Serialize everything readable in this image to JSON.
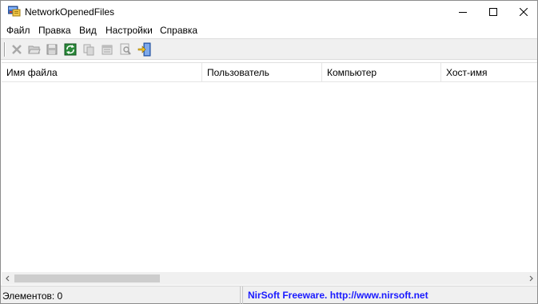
{
  "window": {
    "title": "NetworkOpenedFiles"
  },
  "menu": {
    "items": [
      "Файл",
      "Правка",
      "Вид",
      "Настройки",
      "Справка"
    ]
  },
  "toolbar": {
    "buttons": [
      {
        "icon": "delete-icon",
        "enabled": false
      },
      {
        "icon": "open-folder-icon",
        "enabled": false
      },
      {
        "icon": "save-icon",
        "enabled": false
      },
      {
        "icon": "refresh-icon",
        "enabled": true
      },
      {
        "icon": "copy-icon",
        "enabled": false
      },
      {
        "icon": "html-report-icon",
        "enabled": false
      },
      {
        "icon": "find-icon",
        "enabled": false
      },
      {
        "icon": "exit-icon",
        "enabled": true
      }
    ]
  },
  "table": {
    "columns": [
      "Имя файла",
      "Пользователь",
      "Компьютер",
      "Хост-имя"
    ],
    "rows": []
  },
  "statusbar": {
    "count_text": "Элементов: 0",
    "link_text": "NirSoft Freeware.  http://www.nirsoft.net"
  },
  "colors": {
    "link": "#1a1aff",
    "toolbar_bg": "#f0f0f0"
  }
}
